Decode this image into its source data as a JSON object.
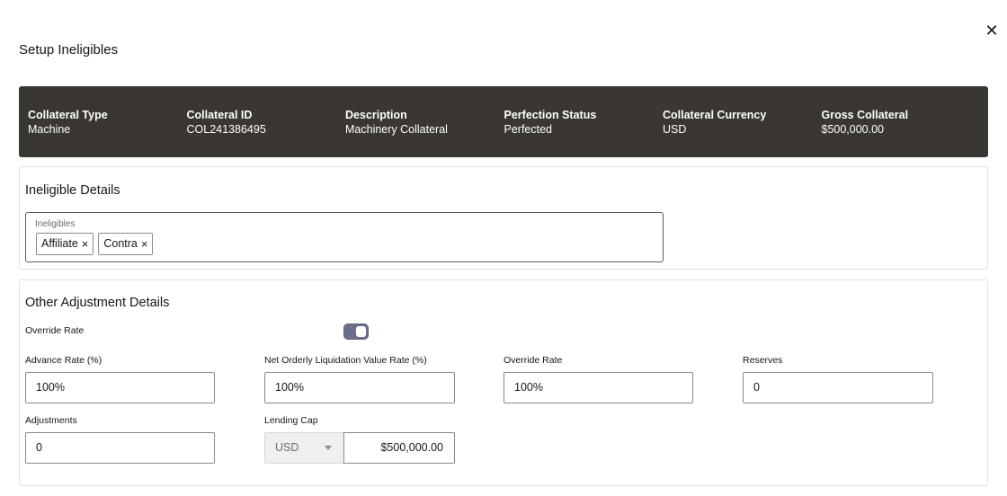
{
  "dialog": {
    "title": "Setup Ineligibles",
    "close_glyph": "✕",
    "close_icon": "close-icon"
  },
  "header": {
    "columns": [
      {
        "label": "Collateral Type",
        "value": "Machine"
      },
      {
        "label": "Collateral ID",
        "value": "COL241386495"
      },
      {
        "label": "Description",
        "value": "Machinery Collateral"
      },
      {
        "label": "Perfection Status",
        "value": "Perfected"
      },
      {
        "label": "Collateral Currency",
        "value": "USD"
      },
      {
        "label": "Gross Collateral",
        "value": "$500,000.00"
      }
    ]
  },
  "ineligible_details": {
    "title": "Ineligible Details",
    "field_label": "Ineligibles",
    "chips": [
      {
        "label": "Affiliate",
        "remove": "×"
      },
      {
        "label": "Contra",
        "remove": "×"
      }
    ]
  },
  "other_adjustments": {
    "title": "Other Adjustment Details",
    "override_toggle_label": "Override Rate",
    "override_toggle_on": true,
    "advance_rate": {
      "label": "Advance Rate (%)",
      "value": "100%"
    },
    "nolv_rate": {
      "label": "Net Orderly Liquidation Value Rate (%)",
      "value": "100%"
    },
    "override_rate": {
      "label": "Override Rate",
      "value": "100%"
    },
    "reserves": {
      "label": "Reserves",
      "value": "0"
    },
    "adjustments": {
      "label": "Adjustments",
      "value": "0"
    },
    "lending_cap": {
      "label": "Lending Cap",
      "currency": "USD",
      "amount": "$500,000.00"
    }
  },
  "colors": {
    "header_band": "#3a3631",
    "toggle_on": "#6c6f8a",
    "border": "#8d8a87"
  }
}
